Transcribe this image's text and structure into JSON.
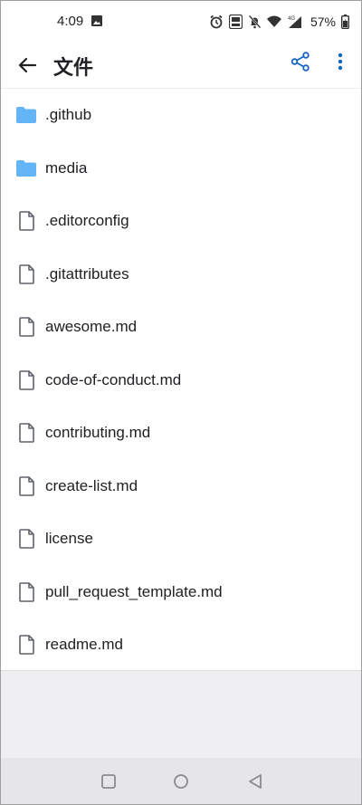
{
  "status_bar": {
    "time": "4:09",
    "network": "4G",
    "battery": "57%"
  },
  "app_bar": {
    "title": "文件"
  },
  "files": [
    {
      "name": ".github",
      "type": "folder"
    },
    {
      "name": "media",
      "type": "folder"
    },
    {
      "name": ".editorconfig",
      "type": "file"
    },
    {
      "name": ".gitattributes",
      "type": "file"
    },
    {
      "name": "awesome.md",
      "type": "file"
    },
    {
      "name": "code-of-conduct.md",
      "type": "file"
    },
    {
      "name": "contributing.md",
      "type": "file"
    },
    {
      "name": "create-list.md",
      "type": "file"
    },
    {
      "name": "license",
      "type": "file"
    },
    {
      "name": "pull_request_template.md",
      "type": "file"
    },
    {
      "name": "readme.md",
      "type": "file"
    }
  ],
  "colors": {
    "accent": "#1565c0",
    "folder": "#64b5f6",
    "file_icon": "#5f6368"
  }
}
